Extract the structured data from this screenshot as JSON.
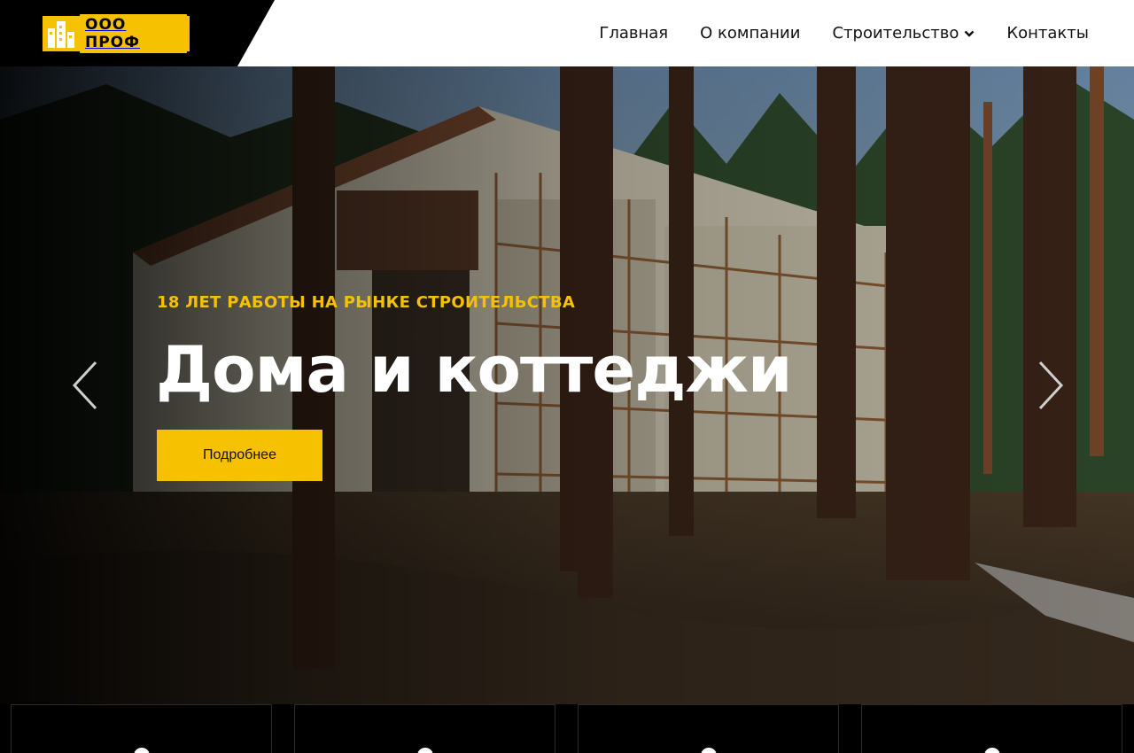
{
  "brand": {
    "logo_text": "ООО ПРОФ",
    "accent": "#f5c100",
    "icon": "building-logo-icon"
  },
  "nav": {
    "items": [
      {
        "label": "Главная"
      },
      {
        "label": "О компании"
      },
      {
        "label": "Строительство",
        "dropdown": true,
        "icon": "chevron-down-icon"
      },
      {
        "label": "Контакты"
      }
    ]
  },
  "hero": {
    "tagline": "18 ЛЕТ РАБОТЫ НА РЫНКЕ СТРОИТЕЛЬСТВА",
    "title": "Дома и коттеджи",
    "cta_label": "Подробнее",
    "prev_icon": "chevron-left-icon",
    "next_icon": "chevron-right-icon",
    "background": "construction-site-in-pine-forest-photo"
  },
  "cards": {
    "count": 4
  }
}
